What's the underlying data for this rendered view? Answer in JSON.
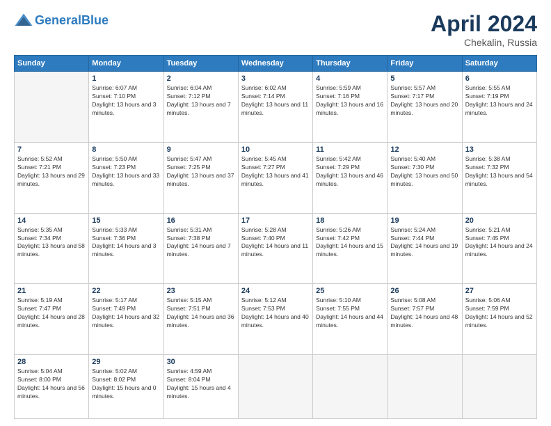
{
  "header": {
    "logo_line1": "General",
    "logo_line2": "Blue",
    "title": "April 2024",
    "subtitle": "Chekalin, Russia"
  },
  "weekdays": [
    "Sunday",
    "Monday",
    "Tuesday",
    "Wednesday",
    "Thursday",
    "Friday",
    "Saturday"
  ],
  "weeks": [
    [
      {
        "day": "",
        "empty": true
      },
      {
        "day": "1",
        "sunrise": "6:07 AM",
        "sunset": "7:10 PM",
        "daylight": "13 hours and 3 minutes."
      },
      {
        "day": "2",
        "sunrise": "6:04 AM",
        "sunset": "7:12 PM",
        "daylight": "13 hours and 7 minutes."
      },
      {
        "day": "3",
        "sunrise": "6:02 AM",
        "sunset": "7:14 PM",
        "daylight": "13 hours and 11 minutes."
      },
      {
        "day": "4",
        "sunrise": "5:59 AM",
        "sunset": "7:16 PM",
        "daylight": "13 hours and 16 minutes."
      },
      {
        "day": "5",
        "sunrise": "5:57 AM",
        "sunset": "7:17 PM",
        "daylight": "13 hours and 20 minutes."
      },
      {
        "day": "6",
        "sunrise": "5:55 AM",
        "sunset": "7:19 PM",
        "daylight": "13 hours and 24 minutes."
      }
    ],
    [
      {
        "day": "7",
        "sunrise": "5:52 AM",
        "sunset": "7:21 PM",
        "daylight": "13 hours and 29 minutes."
      },
      {
        "day": "8",
        "sunrise": "5:50 AM",
        "sunset": "7:23 PM",
        "daylight": "13 hours and 33 minutes."
      },
      {
        "day": "9",
        "sunrise": "5:47 AM",
        "sunset": "7:25 PM",
        "daylight": "13 hours and 37 minutes."
      },
      {
        "day": "10",
        "sunrise": "5:45 AM",
        "sunset": "7:27 PM",
        "daylight": "13 hours and 41 minutes."
      },
      {
        "day": "11",
        "sunrise": "5:42 AM",
        "sunset": "7:29 PM",
        "daylight": "13 hours and 46 minutes."
      },
      {
        "day": "12",
        "sunrise": "5:40 AM",
        "sunset": "7:30 PM",
        "daylight": "13 hours and 50 minutes."
      },
      {
        "day": "13",
        "sunrise": "5:38 AM",
        "sunset": "7:32 PM",
        "daylight": "13 hours and 54 minutes."
      }
    ],
    [
      {
        "day": "14",
        "sunrise": "5:35 AM",
        "sunset": "7:34 PM",
        "daylight": "13 hours and 58 minutes."
      },
      {
        "day": "15",
        "sunrise": "5:33 AM",
        "sunset": "7:36 PM",
        "daylight": "14 hours and 3 minutes."
      },
      {
        "day": "16",
        "sunrise": "5:31 AM",
        "sunset": "7:38 PM",
        "daylight": "14 hours and 7 minutes."
      },
      {
        "day": "17",
        "sunrise": "5:28 AM",
        "sunset": "7:40 PM",
        "daylight": "14 hours and 11 minutes."
      },
      {
        "day": "18",
        "sunrise": "5:26 AM",
        "sunset": "7:42 PM",
        "daylight": "14 hours and 15 minutes."
      },
      {
        "day": "19",
        "sunrise": "5:24 AM",
        "sunset": "7:44 PM",
        "daylight": "14 hours and 19 minutes."
      },
      {
        "day": "20",
        "sunrise": "5:21 AM",
        "sunset": "7:45 PM",
        "daylight": "14 hours and 24 minutes."
      }
    ],
    [
      {
        "day": "21",
        "sunrise": "5:19 AM",
        "sunset": "7:47 PM",
        "daylight": "14 hours and 28 minutes."
      },
      {
        "day": "22",
        "sunrise": "5:17 AM",
        "sunset": "7:49 PM",
        "daylight": "14 hours and 32 minutes."
      },
      {
        "day": "23",
        "sunrise": "5:15 AM",
        "sunset": "7:51 PM",
        "daylight": "14 hours and 36 minutes."
      },
      {
        "day": "24",
        "sunrise": "5:12 AM",
        "sunset": "7:53 PM",
        "daylight": "14 hours and 40 minutes."
      },
      {
        "day": "25",
        "sunrise": "5:10 AM",
        "sunset": "7:55 PM",
        "daylight": "14 hours and 44 minutes."
      },
      {
        "day": "26",
        "sunrise": "5:08 AM",
        "sunset": "7:57 PM",
        "daylight": "14 hours and 48 minutes."
      },
      {
        "day": "27",
        "sunrise": "5:06 AM",
        "sunset": "7:59 PM",
        "daylight": "14 hours and 52 minutes."
      }
    ],
    [
      {
        "day": "28",
        "sunrise": "5:04 AM",
        "sunset": "8:00 PM",
        "daylight": "14 hours and 56 minutes."
      },
      {
        "day": "29",
        "sunrise": "5:02 AM",
        "sunset": "8:02 PM",
        "daylight": "15 hours and 0 minutes."
      },
      {
        "day": "30",
        "sunrise": "4:59 AM",
        "sunset": "8:04 PM",
        "daylight": "15 hours and 4 minutes."
      },
      {
        "day": "",
        "empty": true
      },
      {
        "day": "",
        "empty": true
      },
      {
        "day": "",
        "empty": true
      },
      {
        "day": "",
        "empty": true
      }
    ]
  ],
  "labels": {
    "sunrise": "Sunrise:",
    "sunset": "Sunset:",
    "daylight": "Daylight:"
  }
}
